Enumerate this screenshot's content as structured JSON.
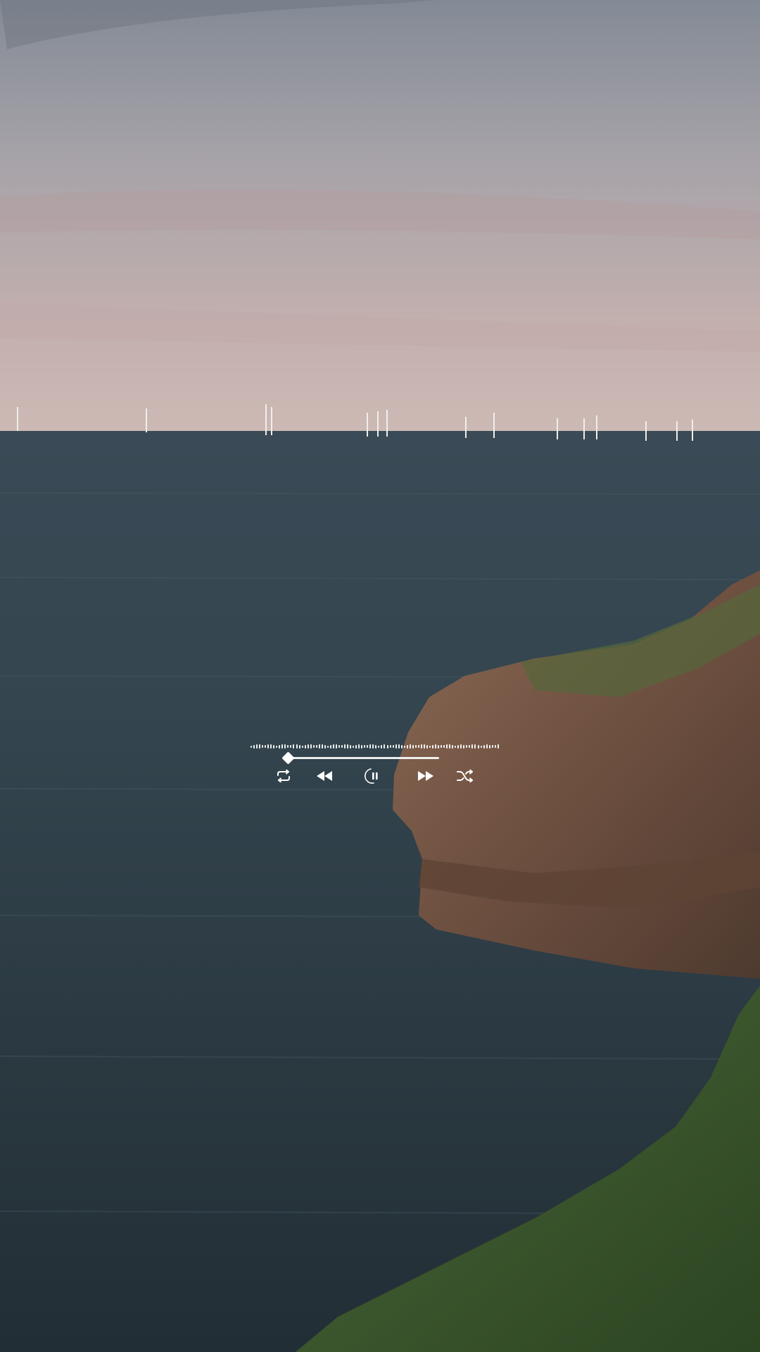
{
  "player": {
    "progress": 0.03,
    "controls": {
      "repeat": {
        "icon": "repeat-icon"
      },
      "rewind": {
        "icon": "rewind-icon"
      },
      "pause": {
        "icon": "pause-icon"
      },
      "fast_forward": {
        "icon": "fast-forward-icon"
      },
      "shuffle": {
        "icon": "shuffle-icon"
      }
    }
  },
  "colors": {
    "sky_top": "#8a9099",
    "sky_horizon": "#c9b1ae",
    "sea_far": "#34444d",
    "sea_near": "#26343b",
    "cliff": "#7a5a48",
    "grass": "#3f5a30",
    "control": "#ffffff"
  }
}
